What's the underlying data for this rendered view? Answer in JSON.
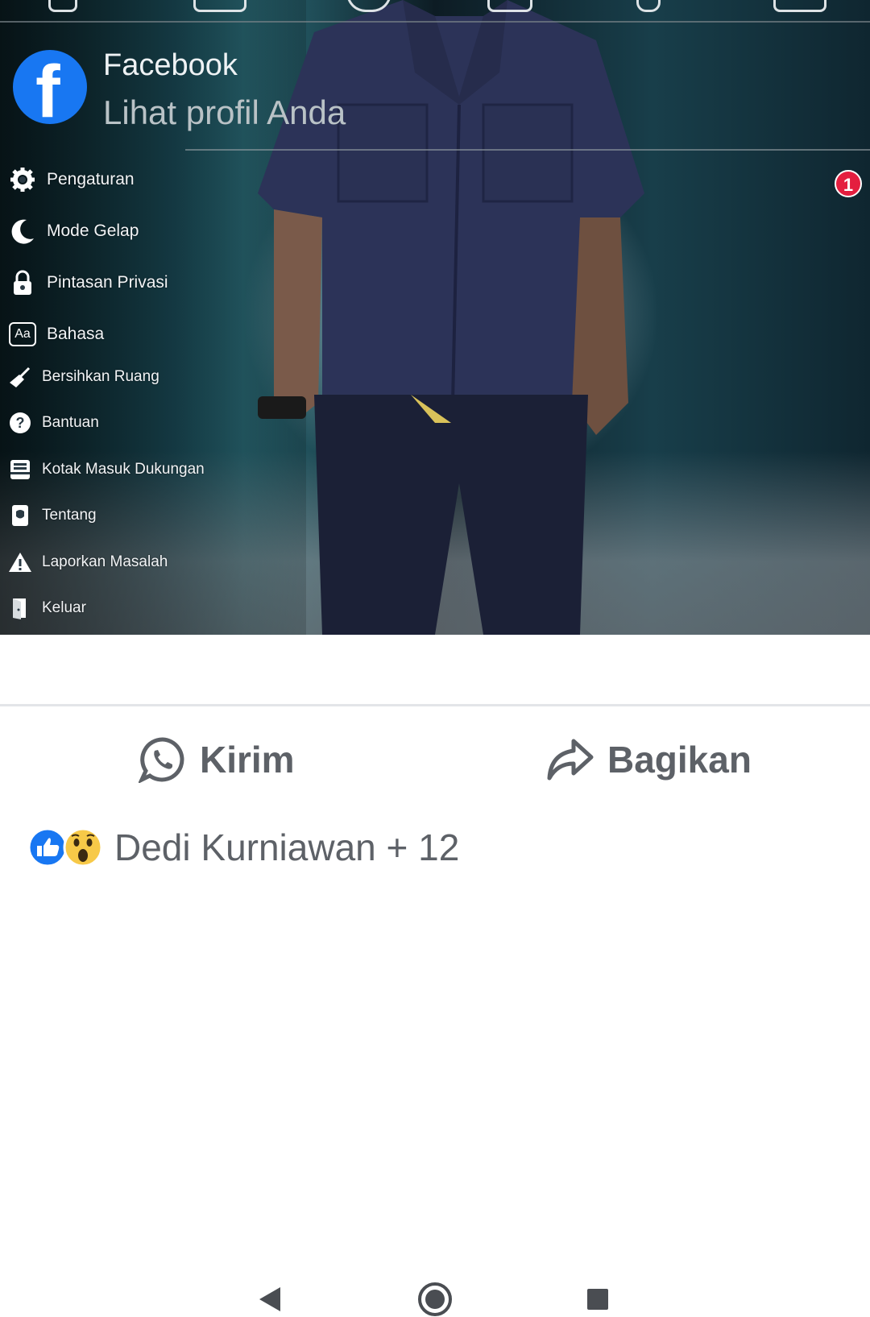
{
  "app": {
    "title": "Facebook",
    "subtitle": "Lihat profil Anda",
    "notification_count": "1"
  },
  "menu": {
    "items": [
      {
        "label": "Pengaturan",
        "icon": "gear-icon"
      },
      {
        "label": "Mode Gelap",
        "icon": "moon-icon"
      },
      {
        "label": "Pintasan Privasi",
        "icon": "lock-icon"
      },
      {
        "label": "Bahasa",
        "icon": "language-icon"
      },
      {
        "label": "Bersihkan Ruang",
        "icon": "broom-icon"
      },
      {
        "label": "Bantuan",
        "icon": "help-icon"
      },
      {
        "label": "Kotak Masuk Dukungan",
        "icon": "inbox-icon"
      },
      {
        "label": "Tentang",
        "icon": "info-book-icon"
      },
      {
        "label": "Laporkan Masalah",
        "icon": "warning-icon"
      },
      {
        "label": "Keluar",
        "icon": "logout-door-icon"
      }
    ],
    "language_icon_text": "Aa"
  },
  "post_actions": {
    "send_label": "Kirim",
    "share_label": "Bagikan"
  },
  "reactions": {
    "summary": "Dedi Kurniawan + 12",
    "types": [
      "like",
      "wow"
    ]
  },
  "colors": {
    "facebook_blue": "#1877f2",
    "badge_red": "#e41e3f",
    "action_gray": "#5d6167"
  }
}
